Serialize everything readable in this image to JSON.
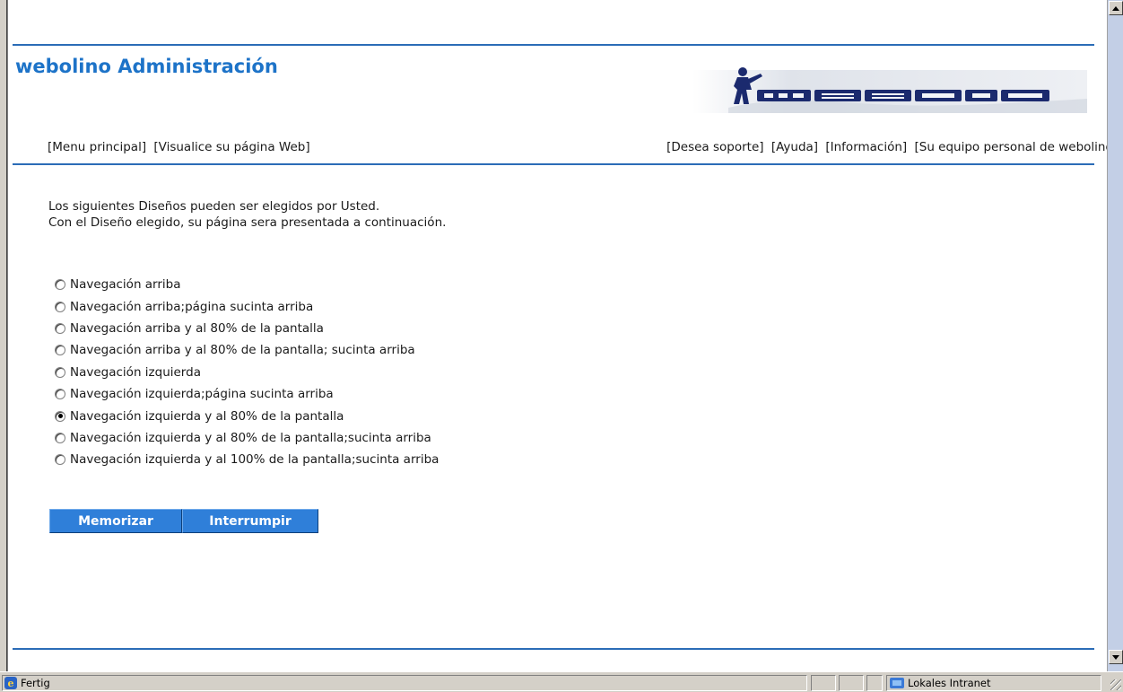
{
  "header": {
    "title": "webolino Administración",
    "logo_text": "WEBOLINO"
  },
  "nav_left": [
    "[Menu principal]",
    "[Visualice su página Web]"
  ],
  "nav_right": [
    "[Desea soporte]",
    "[Ayuda]",
    "[Información]",
    "[Su equipo personal de webolino]"
  ],
  "intro": {
    "line1": "Los siguientes Diseños pueden ser elegidos por Usted.",
    "line2": "Con el Diseño elegido, su página sera presentada a continuación."
  },
  "options": [
    {
      "label": "Navegación arriba",
      "checked": false
    },
    {
      "label": "Navegación arriba;página sucinta arriba",
      "checked": false
    },
    {
      "label": "Navegación arriba y al 80% de la pantalla",
      "checked": false
    },
    {
      "label": "Navegación arriba y al 80% de la pantalla; sucinta arriba",
      "checked": false
    },
    {
      "label": "Navegación izquierda",
      "checked": false
    },
    {
      "label": "Navegación izquierda;página sucinta arriba",
      "checked": false
    },
    {
      "label": "Navegación izquierda y al 80% de la pantalla",
      "checked": true
    },
    {
      "label": "Navegación izquierda y al 80% de la pantalla;sucinta arriba",
      "checked": false
    },
    {
      "label": "Navegación izquierda y al 100% de la pantalla;sucinta arriba",
      "checked": false
    }
  ],
  "buttons": {
    "save": "Memorizar",
    "cancel": "Interrumpir"
  },
  "statusbar": {
    "status": "Fertig",
    "zone": "Lokales Intranet"
  },
  "colors": {
    "accent": "#1d73c8",
    "rule": "#2b6cb7",
    "button": "#2f7fd9"
  }
}
